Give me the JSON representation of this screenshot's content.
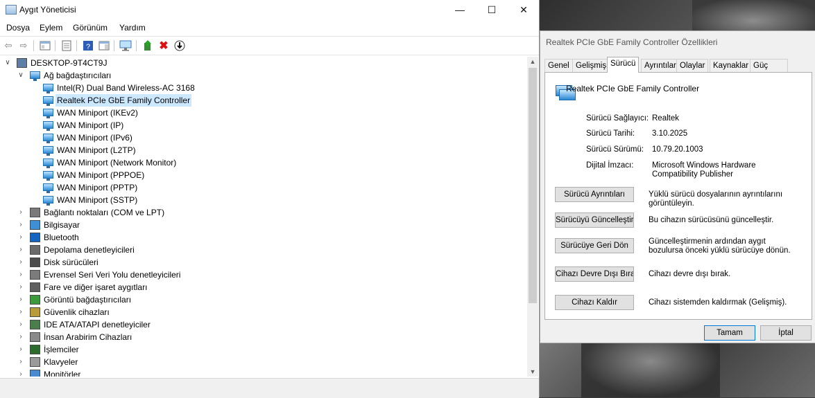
{
  "device_manager": {
    "title": "Aygıt Yöneticisi",
    "menu": [
      "Dosya",
      "Eylem",
      "Görünüm",
      "Yardım"
    ],
    "root": "DESKTOP-9T4CT9J",
    "network_category": "Ağ bağdaştırıcıları",
    "network_items": [
      "Intel(R) Dual Band Wireless-AC 3168",
      "Realtek PCIe GbE Family Controller",
      "WAN Miniport (IKEv2)",
      "WAN Miniport (IP)",
      "WAN Miniport (IPv6)",
      "WAN Miniport (L2TP)",
      "WAN Miniport (Network Monitor)",
      "WAN Miniport (PPPOE)",
      "WAN Miniport (PPTP)",
      "WAN Miniport (SSTP)"
    ],
    "categories": [
      "Bağlantı noktaları (COM ve LPT)",
      "Bilgisayar",
      "Bluetooth",
      "Depolama denetleyicileri",
      "Disk sürücüleri",
      "Evrensel Seri Veri Yolu denetleyicileri",
      "Fare ve diğer işaret aygıtları",
      "Görüntü bağdaştırıcıları",
      "Güvenlik cihazları",
      "IDE ATA/ATAPI denetleyiciler",
      "İnsan Arabirim Cihazları",
      "İşlemciler",
      "Klavyeler",
      "Monitörler"
    ]
  },
  "properties": {
    "title": "Realtek PCIe GbE Family Controller Özellikleri",
    "tabs": [
      "Genel",
      "Gelişmiş",
      "Sürücü",
      "Ayrıntılar",
      "Olaylar",
      "Kaynaklar",
      "Güç Yönetimi"
    ],
    "active_tab": "Sürücü",
    "device_name": "Realtek PCIe GbE Family Controller",
    "fields": {
      "provider_label": "Sürücü Sağlayıcı:",
      "provider_value": "Realtek",
      "date_label": "Sürücü Tarihi:",
      "date_value": "3.10.2025",
      "version_label": "Sürücü Sürümü:",
      "version_value": "10.79.20.1003",
      "signer_label": "Dijital İmzacı:",
      "signer_value": "Microsoft Windows Hardware Compatibility Publisher"
    },
    "actions": [
      {
        "button": "Sürücü Ayrıntıları",
        "desc": "Yüklü sürücü dosyalarının ayrıntılarını görüntüleyin."
      },
      {
        "button": "Sürücüyü Güncelleştir",
        "desc": "Bu cihazın sürücüsünü güncelleştir."
      },
      {
        "button": "Sürücüye Geri Dön",
        "desc": "Güncelleştirmenin ardından aygıt bozulursa önceki yüklü sürücüye dönün."
      },
      {
        "button": "Cihazı Devre Dışı Bırak",
        "desc": "Cihazı devre dışı bırak."
      },
      {
        "button": "Cihazı Kaldır",
        "desc": "Cihazı sistemden kaldırmak (Gelişmiş)."
      }
    ],
    "ok": "Tamam",
    "cancel": "İptal"
  }
}
